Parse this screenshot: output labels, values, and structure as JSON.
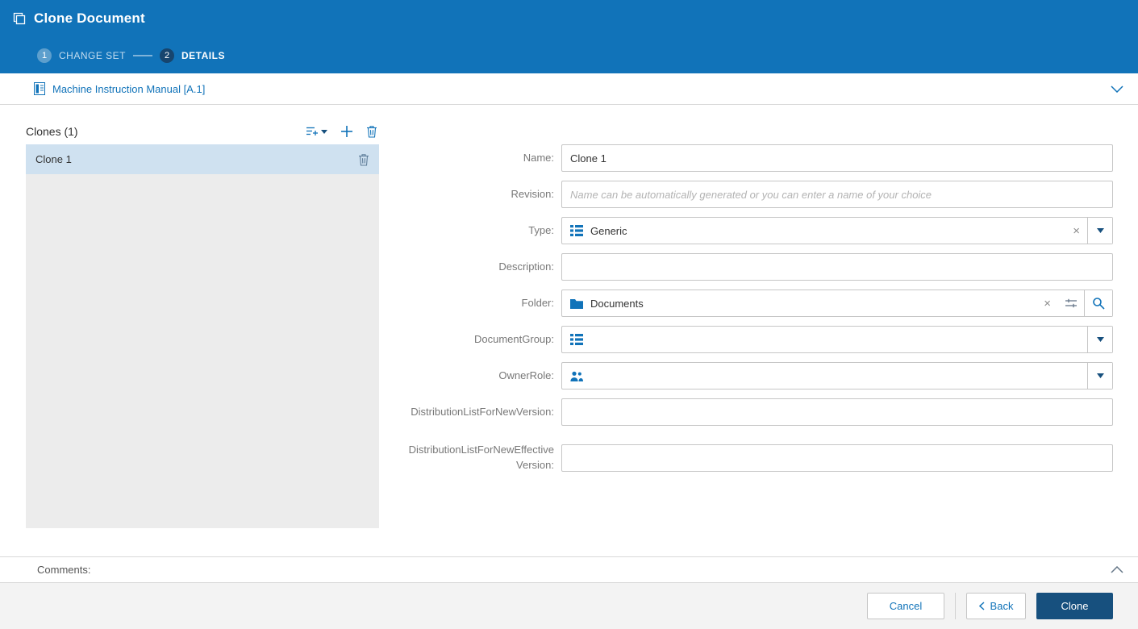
{
  "colors": {
    "accent": "#1173b9",
    "primary_dark": "#17507e",
    "selected_row": "#cfe1f0",
    "list_bg": "#ececec"
  },
  "header": {
    "title": "Clone Document",
    "steps": [
      {
        "number": "1",
        "label": "CHANGE SET"
      },
      {
        "number": "2",
        "label": "DETAILS"
      }
    ]
  },
  "document_bar": {
    "title": "Machine Instruction Manual [A.1]"
  },
  "clones_panel": {
    "title": "Clones (1)",
    "items": [
      {
        "label": "Clone 1"
      }
    ]
  },
  "form": {
    "name": {
      "label": "Name:",
      "value": "Clone 1"
    },
    "revision": {
      "label": "Revision:",
      "value": "",
      "placeholder": "Name can be automatically generated or you can enter a name of your choice"
    },
    "type": {
      "label": "Type:",
      "value": "Generic"
    },
    "description": {
      "label": "Description:",
      "value": ""
    },
    "folder": {
      "label": "Folder:",
      "value": "Documents"
    },
    "document_group": {
      "label": "DocumentGroup:",
      "value": ""
    },
    "owner_role": {
      "label": "OwnerRole:",
      "value": ""
    },
    "distribution_list_new_version": {
      "label": "DistributionListForNewVersion:",
      "value": ""
    },
    "distribution_list_new_effective_version": {
      "label": "DistributionListForNewEffectiveVersion:",
      "value": ""
    }
  },
  "icons": {
    "clear": "×"
  },
  "comments": {
    "label": "Comments:"
  },
  "footer": {
    "cancel_label": "Cancel",
    "back_label": "Back",
    "clone_label": "Clone"
  }
}
